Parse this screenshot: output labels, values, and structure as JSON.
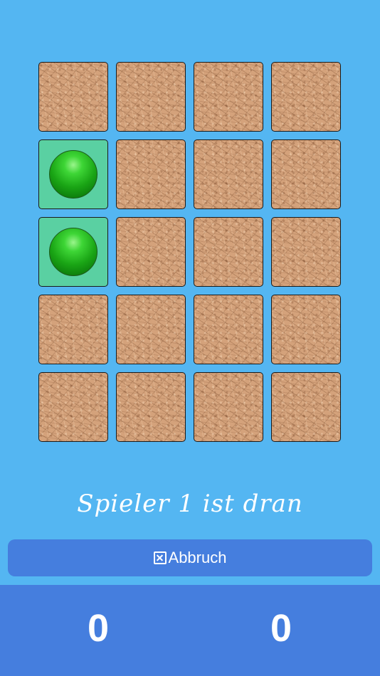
{
  "board": {
    "rows": 5,
    "columns": 4,
    "cards": [
      {
        "state": "hidden"
      },
      {
        "state": "hidden"
      },
      {
        "state": "hidden"
      },
      {
        "state": "hidden"
      },
      {
        "state": "revealed",
        "image": "green-ball"
      },
      {
        "state": "hidden"
      },
      {
        "state": "hidden"
      },
      {
        "state": "hidden"
      },
      {
        "state": "revealed",
        "image": "green-ball"
      },
      {
        "state": "hidden"
      },
      {
        "state": "hidden"
      },
      {
        "state": "hidden"
      },
      {
        "state": "hidden"
      },
      {
        "state": "hidden"
      },
      {
        "state": "hidden"
      },
      {
        "state": "hidden"
      },
      {
        "state": "hidden"
      },
      {
        "state": "hidden"
      },
      {
        "state": "hidden"
      },
      {
        "state": "hidden"
      }
    ]
  },
  "status": {
    "text": "Spieler 1 ist dran"
  },
  "cancel": {
    "label": "Abbruch",
    "icon": "x-square-icon"
  },
  "scores": {
    "player1": "0",
    "player2": "0"
  },
  "colors": {
    "background": "#54b6f2",
    "bar": "#457ede",
    "revealed_card": "#5ad0a2",
    "card_back": "#d4a27b"
  }
}
